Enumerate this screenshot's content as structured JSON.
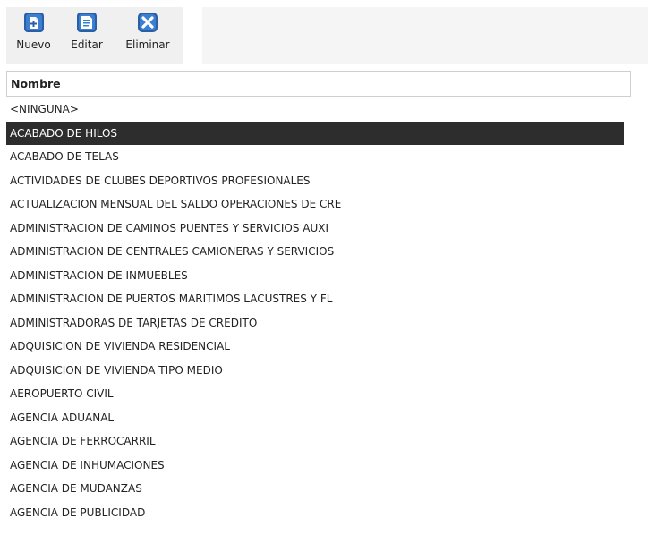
{
  "toolbar": {
    "buttons": [
      {
        "label": "Nuevo",
        "icon": "add-document-icon"
      },
      {
        "label": "Editar",
        "icon": "edit-document-icon"
      },
      {
        "label": "Eliminar",
        "icon": "delete-x-icon"
      }
    ],
    "icon_color": "#2a5fa8"
  },
  "grid": {
    "column_header": "Nombre",
    "selected_index": 1,
    "selected_bg": "#2d2d2d",
    "rows": [
      "<NINGUNA>",
      "ACABADO DE HILOS",
      "ACABADO DE TELAS",
      "ACTIVIDADES DE CLUBES DEPORTIVOS PROFESIONALES",
      "ACTUALIZACION MENSUAL DEL SALDO OPERACIONES DE CRE",
      "ADMINISTRACION DE CAMINOS PUENTES Y SERVICIOS AUXI",
      "ADMINISTRACION DE CENTRALES CAMIONERAS Y SERVICIOS",
      "ADMINISTRACION DE INMUEBLES",
      "ADMINISTRACION DE PUERTOS MARITIMOS LACUSTRES Y FL",
      "ADMINISTRADORAS DE TARJETAS DE CREDITO",
      "ADQUISICION DE VIVIENDA RESIDENCIAL",
      "ADQUISICION DE VIVIENDA TIPO MEDIO",
      "AEROPUERTO CIVIL",
      "AGENCIA ADUANAL",
      "AGENCIA DE FERROCARRIL",
      "AGENCIA DE INHUMACIONES",
      "AGENCIA DE MUDANZAS",
      "AGENCIA DE PUBLICIDAD"
    ]
  }
}
